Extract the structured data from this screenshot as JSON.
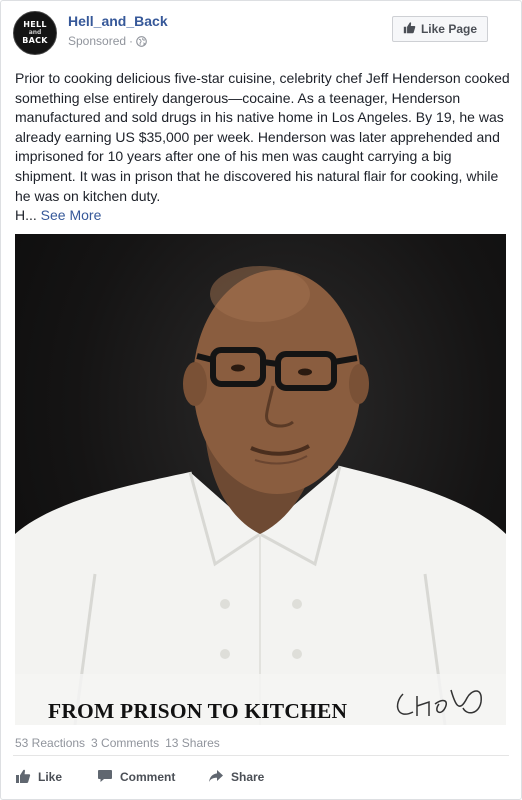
{
  "header": {
    "avatar_line1": "HELL",
    "avatar_line2": "and",
    "avatar_line3": "BACK",
    "page_name": "Hell_and_Back",
    "sponsored_label": "Sponsored",
    "sponsored_separator": "·",
    "like_page_label": "Like Page"
  },
  "post": {
    "text": "Prior to cooking delicious five-star cuisine, celebrity chef Jeff Henderson cooked something else entirely dangerous—cocaine. As a teenager, Henderson manufactured and sold drugs in his native home in Los Angeles. By 19, he was already earning US $35,000 per week. Henderson was later apprehended and imprisoned for 10 years after one of his men was caught carrying a big shipment. It was in prison that he discovered his natural flair for cooking, while he was on kitchen duty.",
    "truncated_start": "H...",
    "see_more_label": "See More"
  },
  "image": {
    "caption": "FROM PRISON TO KITCHEN",
    "signature": "Chef JH",
    "background_color": "#151414",
    "coat_color": "#f3f3f1"
  },
  "stats": {
    "reactions": "53 Reactions",
    "comments": "3 Comments",
    "shares": "13 Shares"
  },
  "actions": {
    "like_label": "Like",
    "comment_label": "Comment",
    "share_label": "Share"
  },
  "colors": {
    "link": "#365899",
    "meta_text": "#90949c",
    "action_text": "#4b4f56",
    "body_text": "#1d2129"
  },
  "icons": {
    "like": "thumbs-up-icon",
    "comment": "speech-bubble-icon",
    "share": "share-arrow-icon",
    "globe": "globe-icon"
  }
}
